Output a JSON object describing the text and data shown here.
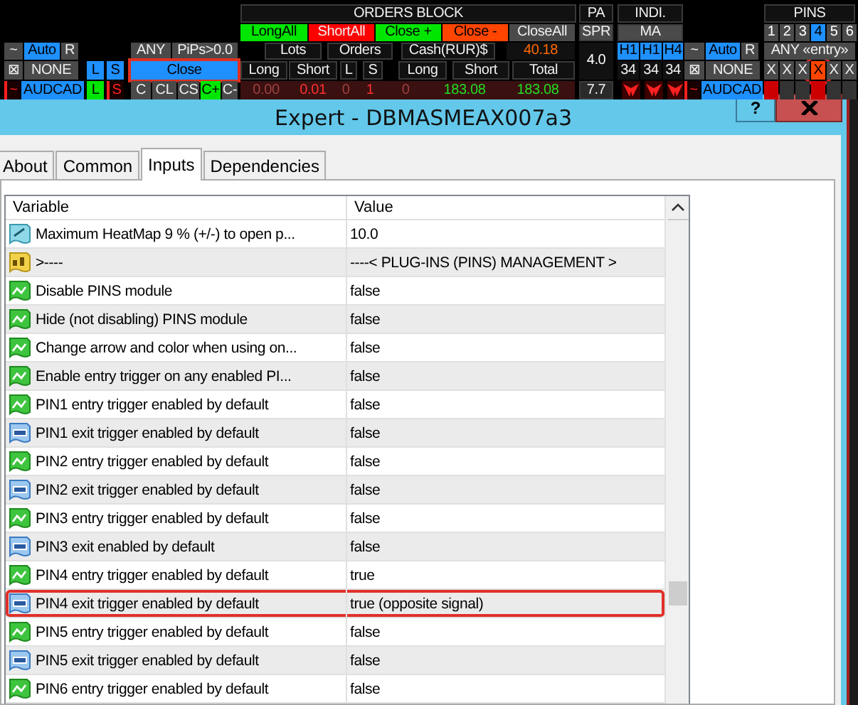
{
  "dashboard": {
    "cells": [
      {
        "kind": "label",
        "text": "ORDERS BLOCK",
        "color": "#111111"
      },
      {
        "kind": "label",
        "text": "PA",
        "color": "#111111"
      },
      {
        "kind": "label",
        "text": "INDI.",
        "color": "#111111"
      },
      {
        "kind": "label",
        "text": "PINS",
        "color": "#111111"
      },
      {
        "kind": "button",
        "text": "LongAll",
        "color": "#00e600"
      },
      {
        "kind": "button",
        "text": "ShortAll",
        "color": "#ff0000"
      },
      {
        "kind": "button",
        "text": "Close +",
        "color": "#00e600"
      },
      {
        "kind": "button",
        "text": "Close -",
        "color": "#ff4500"
      },
      {
        "kind": "button",
        "text": "CloseAll",
        "color": "#4a4a4a"
      },
      {
        "kind": "label",
        "text": "SPR",
        "color": "#4a4a4a"
      },
      {
        "kind": "label",
        "text": "MA",
        "color": "#4a4a4a"
      },
      {
        "kind": "pin",
        "text": "1",
        "selected": false
      },
      {
        "kind": "pin",
        "text": "2",
        "selected": false
      },
      {
        "kind": "pin",
        "text": "3",
        "selected": false
      },
      {
        "kind": "pin",
        "text": "4",
        "selected": true
      },
      {
        "kind": "pin",
        "text": "5",
        "selected": false
      },
      {
        "kind": "pin",
        "text": "6",
        "selected": false
      },
      {
        "kind": "button",
        "text": "~",
        "color": "#4a4a4a"
      },
      {
        "kind": "button",
        "text": "Auto",
        "color": "#1e90ff"
      },
      {
        "kind": "button",
        "text": "R",
        "color": "#4a4a4a"
      },
      {
        "kind": "button",
        "text": "ANY",
        "color": "#4a4a4a"
      },
      {
        "kind": "button",
        "text": "PiPs>0.0",
        "color": "#4a4a4a"
      },
      {
        "kind": "label",
        "text": "Lots",
        "color": "#111111"
      },
      {
        "kind": "label",
        "text": "Orders",
        "color": "#111111"
      },
      {
        "kind": "label",
        "text": "Cash(RUR)$",
        "color": "#111111"
      },
      {
        "kind": "value",
        "text": "40.18",
        "color": "#ff6a00"
      },
      {
        "kind": "value",
        "text": "4.0",
        "color": "#ffffff"
      },
      {
        "kind": "button",
        "text": "H1",
        "color": "#1e90ff"
      },
      {
        "kind": "button",
        "text": "H1",
        "color": "#1e90ff"
      },
      {
        "kind": "button",
        "text": "H4",
        "color": "#1e90ff"
      },
      {
        "kind": "button",
        "text": "~",
        "color": "#4a4a4a"
      },
      {
        "kind": "button",
        "text": "Auto",
        "color": "#1e90ff"
      },
      {
        "kind": "button",
        "text": "R",
        "color": "#4a4a4a"
      },
      {
        "kind": "button",
        "text": "ANY «entry»",
        "color": "#4a4a4a"
      },
      {
        "kind": "button",
        "text": "⊠",
        "color": "#4a4a4a"
      },
      {
        "kind": "button",
        "text": "NONE",
        "color": "#4a4a4a"
      },
      {
        "kind": "button",
        "text": "L",
        "color": "#1e90ff"
      },
      {
        "kind": "button",
        "text": "S",
        "color": "#1e90ff"
      },
      {
        "kind": "button",
        "text": "Close",
        "color": "#1e90ff",
        "outlined": true
      },
      {
        "kind": "label",
        "text": "Long",
        "color": "#111111"
      },
      {
        "kind": "label",
        "text": "Short",
        "color": "#111111"
      },
      {
        "kind": "label",
        "text": "L",
        "color": "#111111"
      },
      {
        "kind": "label",
        "text": "S",
        "color": "#111111"
      },
      {
        "kind": "label",
        "text": "Long",
        "color": "#111111"
      },
      {
        "kind": "label",
        "text": "Short",
        "color": "#111111"
      },
      {
        "kind": "label",
        "text": "Total",
        "color": "#111111"
      },
      {
        "kind": "button",
        "text": "34",
        "color": "#111111"
      },
      {
        "kind": "button",
        "text": "34",
        "color": "#111111"
      },
      {
        "kind": "button",
        "text": "34",
        "color": "#111111"
      },
      {
        "kind": "button",
        "text": "⊠",
        "color": "#4a4a4a"
      },
      {
        "kind": "button",
        "text": "NONE",
        "color": "#4a4a4a"
      },
      {
        "kind": "button",
        "text": "X",
        "color": "#4a4a4a"
      },
      {
        "kind": "button",
        "text": "X",
        "color": "#4a4a4a"
      },
      {
        "kind": "button",
        "text": "X",
        "color": "#4a4a4a"
      },
      {
        "kind": "button",
        "text": "X",
        "color": "#ff4500",
        "circled": true
      },
      {
        "kind": "button",
        "text": "X",
        "color": "#4a4a4a"
      },
      {
        "kind": "button",
        "text": "X",
        "color": "#4a4a4a"
      },
      {
        "kind": "signal",
        "text": "~",
        "color": "#ff2020"
      },
      {
        "kind": "button",
        "text": "AUDCAD",
        "color": "#1e90ff"
      },
      {
        "kind": "button",
        "text": "L",
        "color": "#00e600"
      },
      {
        "kind": "signal",
        "text": "S",
        "color": "#ff2020"
      },
      {
        "kind": "button",
        "text": "C",
        "color": "#4a4a4a"
      },
      {
        "kind": "button",
        "text": "CL",
        "color": "#4a4a4a"
      },
      {
        "kind": "button",
        "text": "CS",
        "color": "#4a4a4a"
      },
      {
        "kind": "button",
        "text": "C+",
        "color": "#00e600"
      },
      {
        "kind": "button",
        "text": "C-",
        "color": "#4a4a4a"
      },
      {
        "kind": "value",
        "text": "0.00",
        "color": "#a04040"
      },
      {
        "kind": "value",
        "text": "0.01",
        "color": "#ff3030"
      },
      {
        "kind": "value",
        "text": "0",
        "color": "#a04040"
      },
      {
        "kind": "value",
        "text": "1",
        "color": "#ff3030"
      },
      {
        "kind": "value",
        "text": "0",
        "color": "#a04040"
      },
      {
        "kind": "value",
        "text": "183.08",
        "color": "#22dd22"
      },
      {
        "kind": "value",
        "text": "183.08",
        "color": "#22dd22"
      },
      {
        "kind": "label",
        "text": "7.7",
        "color": "#2a2a2a"
      },
      {
        "kind": "arrow",
        "color": "#ff2020"
      },
      {
        "kind": "arrow",
        "color": "#ff2020"
      },
      {
        "kind": "arrow",
        "color": "#ff2020"
      },
      {
        "kind": "signal",
        "text": "~",
        "color": "#ff2020"
      },
      {
        "kind": "button",
        "text": "AUDCAD",
        "color": "#1e90ff"
      },
      {
        "kind": "box",
        "color": "#cc0000"
      },
      {
        "kind": "box",
        "color": "#333333"
      },
      {
        "kind": "box",
        "color": "#333333"
      },
      {
        "kind": "box",
        "color": "#cc0000"
      },
      {
        "kind": "box",
        "color": "#333333"
      },
      {
        "kind": "box",
        "color": "#333333"
      }
    ]
  },
  "window": {
    "title": "Expert - DBMASMEAX007a3",
    "help_button": "?"
  },
  "tabs": [
    {
      "label": "About",
      "selected": false
    },
    {
      "label": "Common",
      "selected": false
    },
    {
      "label": "Inputs",
      "selected": true
    },
    {
      "label": "Dependencies",
      "selected": false
    }
  ],
  "table": {
    "columns": [
      "Variable",
      "Value"
    ],
    "rows": [
      {
        "kind": "double",
        "variable": "Maximum HeatMap 9 % (+/-) to open p...",
        "value": "10.0",
        "highlighted": false
      },
      {
        "kind": "string",
        "variable": ">----",
        "value": "----< PLUG-INS (PINS) MANAGEMENT >",
        "highlighted": false
      },
      {
        "kind": "bool",
        "variable": "Disable PINS module",
        "value": "false",
        "highlighted": false
      },
      {
        "kind": "bool",
        "variable": "Hide (not disabling) PINS module",
        "value": "false",
        "highlighted": false
      },
      {
        "kind": "bool",
        "variable": "Change arrow and color when using on...",
        "value": "false",
        "highlighted": false
      },
      {
        "kind": "bool",
        "variable": "Enable entry trigger on any enabled PI...",
        "value": "false",
        "highlighted": false
      },
      {
        "kind": "bool",
        "variable": "PIN1 entry trigger enabled by default",
        "value": "false",
        "highlighted": false
      },
      {
        "kind": "int",
        "variable": "PIN1 exit trigger enabled by default",
        "value": "false",
        "highlighted": false
      },
      {
        "kind": "bool",
        "variable": "PIN2 entry trigger enabled by default",
        "value": "false",
        "highlighted": false
      },
      {
        "kind": "int",
        "variable": "PIN2 exit trigger enabled by default",
        "value": "false",
        "highlighted": false
      },
      {
        "kind": "bool",
        "variable": "PIN3 entry trigger enabled by default",
        "value": "false",
        "highlighted": false
      },
      {
        "kind": "int",
        "variable": "PIN3 exit enabled by default",
        "value": "false",
        "highlighted": false
      },
      {
        "kind": "bool",
        "variable": "PIN4 entry trigger enabled by default",
        "value": "true",
        "highlighted": false
      },
      {
        "kind": "int",
        "variable": "PIN4 exit trigger enabled by default",
        "value": "true (opposite signal)",
        "highlighted": true
      },
      {
        "kind": "bool",
        "variable": "PIN5 entry trigger enabled by default",
        "value": "false",
        "highlighted": false
      },
      {
        "kind": "int",
        "variable": "PIN5 exit trigger enabled by default",
        "value": "false",
        "highlighted": false
      },
      {
        "kind": "bool",
        "variable": "PIN6 entry trigger enabled by default",
        "value": "false",
        "highlighted": false
      }
    ]
  }
}
